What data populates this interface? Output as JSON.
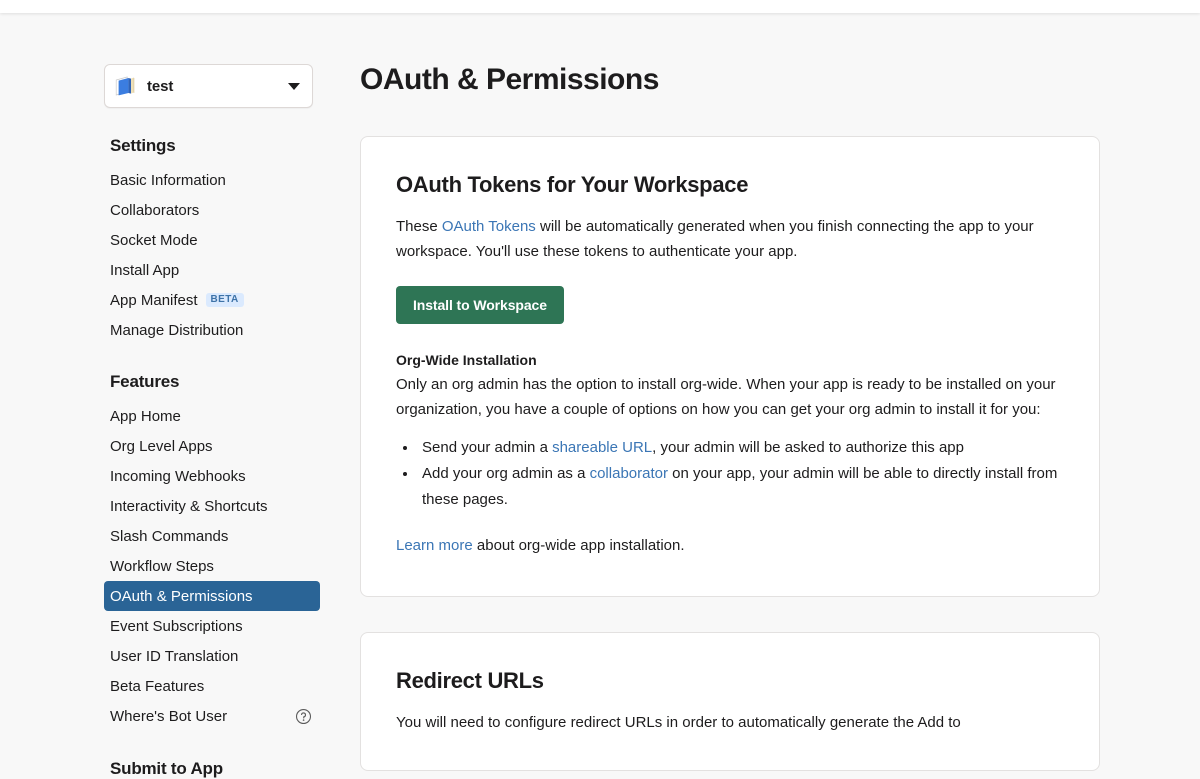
{
  "sidebar": {
    "app_selector": {
      "name": "test",
      "icon": "notebook-icon",
      "chevron": "chevron-down-icon"
    },
    "sections": [
      {
        "heading": "Settings",
        "items": [
          {
            "label": "Basic Information",
            "badge": null,
            "active": false,
            "help": false
          },
          {
            "label": "Collaborators",
            "badge": null,
            "active": false,
            "help": false
          },
          {
            "label": "Socket Mode",
            "badge": null,
            "active": false,
            "help": false
          },
          {
            "label": "Install App",
            "badge": null,
            "active": false,
            "help": false
          },
          {
            "label": "App Manifest",
            "badge": "BETA",
            "active": false,
            "help": false
          },
          {
            "label": "Manage Distribution",
            "badge": null,
            "active": false,
            "help": false
          }
        ]
      },
      {
        "heading": "Features",
        "items": [
          {
            "label": "App Home",
            "badge": null,
            "active": false,
            "help": false
          },
          {
            "label": "Org Level Apps",
            "badge": null,
            "active": false,
            "help": false
          },
          {
            "label": "Incoming Webhooks",
            "badge": null,
            "active": false,
            "help": false
          },
          {
            "label": "Interactivity & Shortcuts",
            "badge": null,
            "active": false,
            "help": false
          },
          {
            "label": "Slash Commands",
            "badge": null,
            "active": false,
            "help": false
          },
          {
            "label": "Workflow Steps",
            "badge": null,
            "active": false,
            "help": false
          },
          {
            "label": "OAuth & Permissions",
            "badge": null,
            "active": true,
            "help": false
          },
          {
            "label": "Event Subscriptions",
            "badge": null,
            "active": false,
            "help": false
          },
          {
            "label": "User ID Translation",
            "badge": null,
            "active": false,
            "help": false
          },
          {
            "label": "Beta Features",
            "badge": null,
            "active": false,
            "help": false
          },
          {
            "label": "Where's Bot User",
            "badge": null,
            "active": false,
            "help": true
          }
        ]
      },
      {
        "heading": "Submit to App",
        "items": []
      }
    ]
  },
  "main": {
    "page_title": "OAuth & Permissions",
    "tokens_card": {
      "title": "OAuth Tokens for Your Workspace",
      "intro_before_link": "These ",
      "intro_link": "OAuth Tokens",
      "intro_after_link": " will be automatically generated when you finish connecting the app to your workspace. You'll use these tokens to authenticate your app.",
      "install_button": "Install to Workspace",
      "org_wide_heading": "Org-Wide Installation",
      "org_wide_text": "Only an org admin has the option to install org-wide. When your app is ready to be installed on your organization, you have a couple of options on how you can get your org admin to install it for you:",
      "bullet1_before": "Send your admin a ",
      "bullet1_link": "shareable URL",
      "bullet1_after": ", your admin will be asked to authorize this app",
      "bullet2_before": "Add your org admin as a ",
      "bullet2_link": "collaborator",
      "bullet2_after": " on your app, your admin will be able to directly install from these pages.",
      "learn_more_link": "Learn more",
      "learn_more_after": " about org-wide app installation."
    },
    "redirect_card": {
      "title": "Redirect URLs",
      "text": "You will need to configure redirect URLs in order to automatically generate the Add to"
    }
  },
  "colors": {
    "accent_blue": "#2a6496",
    "link_blue": "#3b76b5",
    "install_green": "#2e7555",
    "badge_bg": "#dbeafe",
    "badge_text": "#3e73a8",
    "page_bg": "#f8f8f8"
  }
}
